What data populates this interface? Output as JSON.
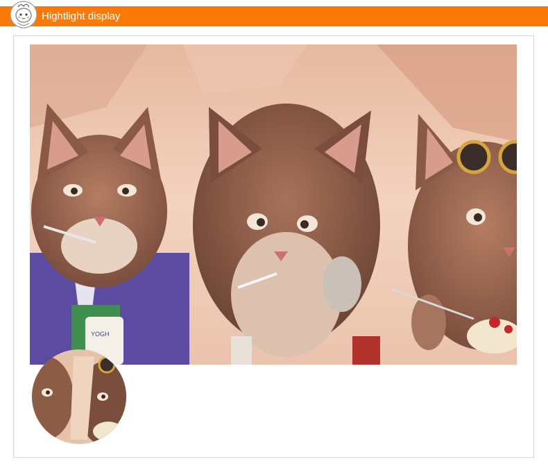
{
  "header": {
    "title": "Hightlight display",
    "background_color": "#f97a06",
    "logo_icon": "cartoon-mascot-face-icon"
  },
  "main_image": {
    "icon": "three-cats-vintage-poster-image",
    "accent_colors": [
      "#c78a72",
      "#5a47a0",
      "#f0c8b0"
    ]
  },
  "thumbnail": {
    "icon": "round-cat-thumbnail-image"
  }
}
